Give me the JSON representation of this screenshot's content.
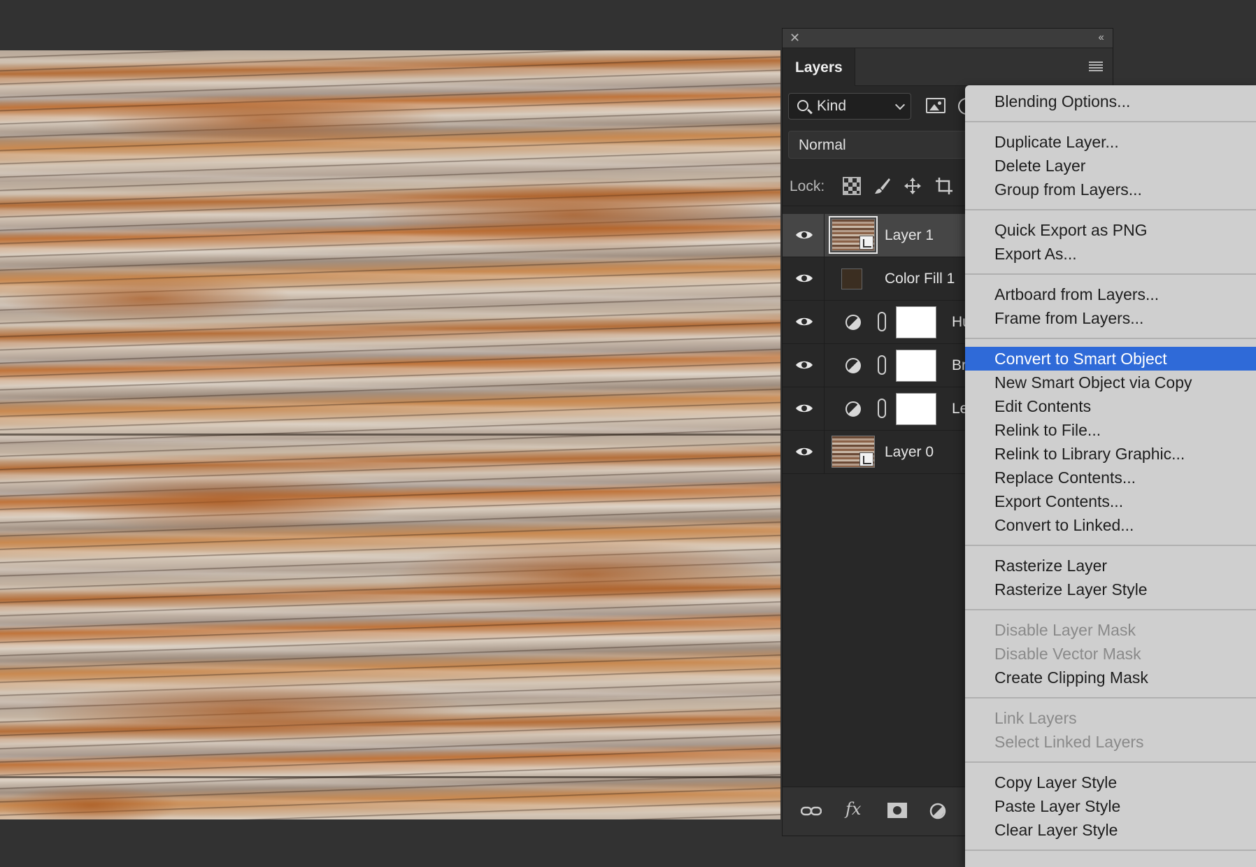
{
  "panel": {
    "close_glyph": "✕",
    "collapse_glyph": "‹‹",
    "tab_label": "Layers",
    "filter_kind_label": "Kind",
    "blend_mode": "Normal",
    "lock_label": "Lock:",
    "footer_fx_label": "fx"
  },
  "layers": [
    {
      "name": "Layer 1",
      "type": "smart-object",
      "selected": true
    },
    {
      "name": "Color Fill 1",
      "type": "fill",
      "fill_color": "#3b2e21"
    },
    {
      "name": "Hu",
      "type": "adjustment"
    },
    {
      "name": "Br",
      "type": "adjustment"
    },
    {
      "name": "Le",
      "type": "adjustment"
    },
    {
      "name": "Layer 0",
      "type": "smart-object"
    }
  ],
  "context_menu": {
    "groups": [
      {
        "items": [
          {
            "label": "Blending Options..."
          }
        ]
      },
      {
        "items": [
          {
            "label": "Duplicate Layer..."
          },
          {
            "label": "Delete Layer"
          },
          {
            "label": "Group from Layers..."
          }
        ]
      },
      {
        "items": [
          {
            "label": "Quick Export as PNG"
          },
          {
            "label": "Export As..."
          }
        ]
      },
      {
        "items": [
          {
            "label": "Artboard from Layers..."
          },
          {
            "label": "Frame from Layers..."
          }
        ]
      },
      {
        "items": [
          {
            "label": "Convert to Smart Object",
            "highlighted": true
          },
          {
            "label": "New Smart Object via Copy"
          },
          {
            "label": "Edit Contents"
          },
          {
            "label": "Relink to File..."
          },
          {
            "label": "Relink to Library Graphic..."
          },
          {
            "label": "Replace Contents..."
          },
          {
            "label": "Export Contents..."
          },
          {
            "label": "Convert to Linked..."
          }
        ]
      },
      {
        "items": [
          {
            "label": "Rasterize Layer"
          },
          {
            "label": "Rasterize Layer Style"
          }
        ]
      },
      {
        "items": [
          {
            "label": "Disable Layer Mask",
            "disabled": true
          },
          {
            "label": "Disable Vector Mask",
            "disabled": true
          },
          {
            "label": "Create Clipping Mask"
          }
        ]
      },
      {
        "items": [
          {
            "label": "Link Layers",
            "disabled": true
          },
          {
            "label": "Select Linked Layers",
            "disabled": true
          }
        ]
      },
      {
        "items": [
          {
            "label": "Copy Layer Style"
          },
          {
            "label": "Paste Layer Style"
          },
          {
            "label": "Clear Layer Style"
          }
        ]
      }
    ]
  },
  "colors": {
    "menu_highlight": "#2f6ad8",
    "menu_background": "#cfcfcf",
    "panel_background": "#282828",
    "app_background": "#323232"
  }
}
